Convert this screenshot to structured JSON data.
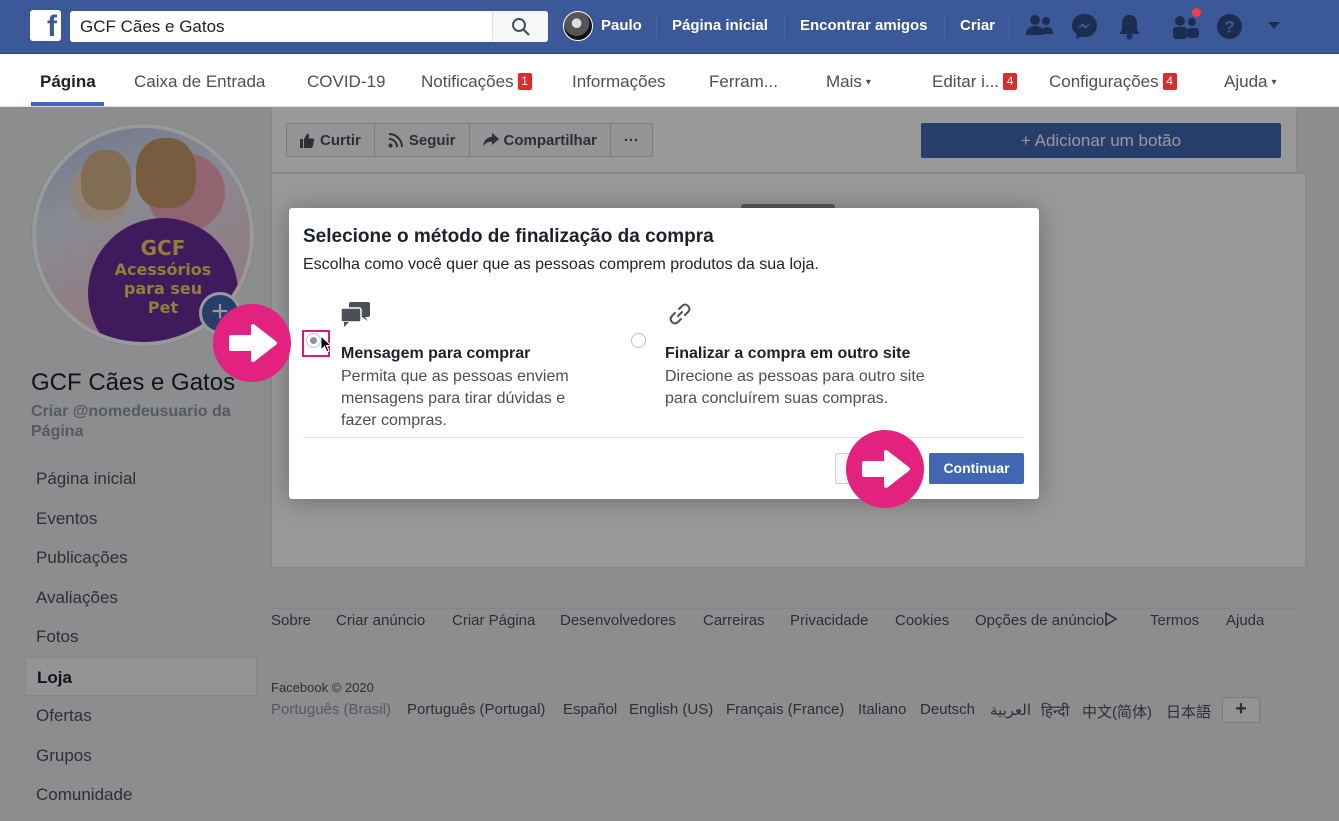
{
  "topbar": {
    "search_value": "GCF Cães e Gatos",
    "profile_name": "Paulo",
    "nav": [
      "Página inicial",
      "Encontrar amigos",
      "Criar"
    ],
    "icons": [
      "friend-requests-icon",
      "messenger-icon",
      "notifications-icon",
      "groups-icon",
      "help-icon",
      "dropdown-icon"
    ]
  },
  "page_tabs": [
    {
      "label": "Página",
      "active": true
    },
    {
      "label": "Caixa de Entrada"
    },
    {
      "label": "COVID-19"
    },
    {
      "label": "Notificações",
      "badge": "1"
    },
    {
      "label": "Informações"
    },
    {
      "label": "Ferram..."
    },
    {
      "label": "Mais",
      "caret": "▾"
    },
    {
      "label": "Editar i...",
      "badge": "4"
    },
    {
      "label": "Configurações",
      "badge": "4"
    },
    {
      "label": "Ajuda",
      "caret": "▾"
    }
  ],
  "profile": {
    "logo_line1": "GCF",
    "logo_line2": "Acessórios",
    "logo_line3": "para seu",
    "logo_line4": "Pet",
    "page_name": "GCF Cães e Gatos",
    "username_prompt": "Criar @nomedeusuario da Página"
  },
  "sidebar": {
    "items": [
      {
        "label": "Página inicial"
      },
      {
        "label": "Eventos"
      },
      {
        "label": "Publicações"
      },
      {
        "label": "Avaliações"
      },
      {
        "label": "Fotos"
      },
      {
        "label": "Loja",
        "active": true
      },
      {
        "label": "Ofertas"
      },
      {
        "label": "Grupos"
      },
      {
        "label": "Comunidade"
      }
    ]
  },
  "actions": {
    "like": "Curtir",
    "follow": "Seguir",
    "share": "Compartilhar",
    "more": "···",
    "add_button": "+ Adicionar um botão"
  },
  "modal": {
    "title": "Selecione o método de finalização da compra",
    "subtitle": "Escolha como você quer que as pessoas comprem produtos da sua loja.",
    "option1": {
      "title": "Mensagem para comprar",
      "desc": "Permita que as pessoas enviem mensagens para tirar dúvidas e fazer compras.",
      "selected": true
    },
    "option2": {
      "title": "Finalizar a compra em outro site",
      "desc": "Direcione as pessoas para outro site para concluírem suas compras.",
      "selected": false
    },
    "continue": "Continuar"
  },
  "footer": {
    "links": [
      "Sobre",
      "Criar anúncio",
      "Criar Página",
      "Desenvolvedores",
      "Carreiras",
      "Privacidade",
      "Cookies",
      "Opções de anúncio",
      "Termos",
      "Ajuda"
    ],
    "copyright": "Facebook © 2020",
    "languages": [
      "Português (Brasil)",
      "Português (Portugal)",
      "Español",
      "English (US)",
      "Français (France)",
      "Italiano",
      "Deutsch",
      "العربية",
      "हिन्दी",
      "中文(简体)",
      "日本語"
    ],
    "more_languages": "+"
  },
  "colors": {
    "facebook_blue": "#3b5998",
    "button_blue": "#4267b2",
    "highlight_pink": "#e3217f",
    "badge_red": "#e02a2a"
  }
}
